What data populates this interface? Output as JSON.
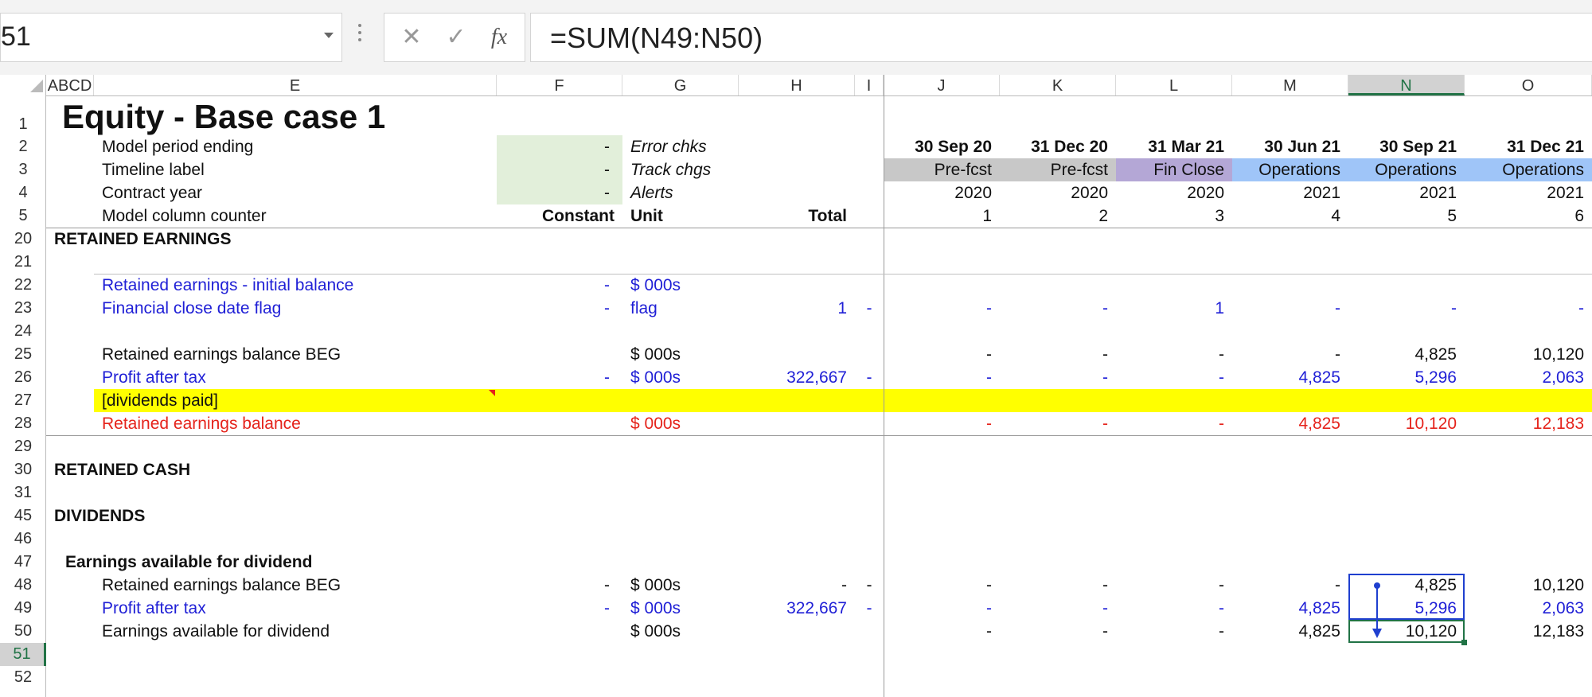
{
  "name_box": "51",
  "formula": "=SUM(N49:N50)",
  "formula_buttons": {
    "cancel": "✕",
    "enter": "✓",
    "fx": "fx"
  },
  "columns": [
    "ABCD",
    "E",
    "F",
    "G",
    "H",
    "I",
    "J",
    "K",
    "L",
    "M",
    "N",
    "O"
  ],
  "selected_column": "N",
  "rows": [
    "1",
    "2",
    "3",
    "4",
    "5",
    "20",
    "21",
    "22",
    "23",
    "24",
    "25",
    "26",
    "27",
    "28",
    "29",
    "30",
    "31",
    "45",
    "46",
    "47",
    "48",
    "49",
    "50",
    "51",
    "52"
  ],
  "selected_row": "51",
  "title": "Equity - Base case 1",
  "header_rows": {
    "r2": {
      "label": "Model period ending",
      "f": "-",
      "g": "Error chks"
    },
    "r3": {
      "label": "Timeline label",
      "f": "-",
      "g": "Track chgs"
    },
    "r4": {
      "label": "Contract year",
      "f": "-",
      "g": "Alerts"
    },
    "r5": {
      "label": "Model column counter",
      "f": "Constant",
      "g": "Unit",
      "h": "Total"
    }
  },
  "periods": [
    {
      "date": "30 Sep 20",
      "label": "Pre-fcst",
      "year": "2020",
      "counter": "1",
      "bg": "#c8c8c8"
    },
    {
      "date": "31 Dec 20",
      "label": "Pre-fcst",
      "year": "2020",
      "counter": "2",
      "bg": "#c8c8c8"
    },
    {
      "date": "31 Mar 21",
      "label": "Fin Close",
      "year": "2020",
      "counter": "3",
      "bg": "#b4a7d6"
    },
    {
      "date": "30 Jun 21",
      "label": "Operations",
      "year": "2021",
      "counter": "4",
      "bg": "#9fc5f8"
    },
    {
      "date": "30 Sep 21",
      "label": "Operations",
      "year": "2021",
      "counter": "5",
      "bg": "#9fc5f8"
    },
    {
      "date": "31 Dec 21",
      "label": "Operations",
      "year": "2021",
      "counter": "6",
      "bg": "#9fc5f8"
    }
  ],
  "sections": {
    "retained_earnings": "RETAINED EARNINGS",
    "retained_cash": "RETAINED CASH",
    "dividends": "DIVIDENDS",
    "earnings_available": "Earnings available for dividend"
  },
  "lines": {
    "r22": {
      "label": "Retained earnings - initial balance",
      "f": "-",
      "unit": "$ 000s"
    },
    "r23": {
      "label": "Financial close date flag",
      "f": "-",
      "unit": "flag",
      "total": "1",
      "i": "-",
      "vals": [
        "-",
        "-",
        "1",
        "-",
        "-",
        "-"
      ]
    },
    "r25": {
      "label": "Retained earnings balance BEG",
      "unit": "$ 000s",
      "vals": [
        "-",
        "-",
        "-",
        "-",
        "4,825",
        "10,120"
      ]
    },
    "r26": {
      "label": "Profit after tax",
      "f": "-",
      "unit": "$ 000s",
      "total": "322,667",
      "i": "-",
      "vals": [
        "-",
        "-",
        "-",
        "4,825",
        "5,296",
        "2,063"
      ]
    },
    "r27": {
      "label": "[dividends paid]"
    },
    "r28": {
      "label": "Retained earnings balance",
      "unit": "$ 000s",
      "vals": [
        "-",
        "-",
        "-",
        "4,825",
        "10,120",
        "12,183"
      ]
    },
    "r49": {
      "label": "Retained earnings balance BEG",
      "f": "-",
      "unit": "$ 000s",
      "total": "-",
      "i": "-",
      "vals": [
        "-",
        "-",
        "-",
        "-",
        "4,825",
        "10,120"
      ]
    },
    "r50": {
      "label": "Profit after tax",
      "f": "-",
      "unit": "$ 000s",
      "total": "322,667",
      "i": "-",
      "vals": [
        "-",
        "-",
        "-",
        "4,825",
        "5,296",
        "2,063"
      ]
    },
    "r51": {
      "label": "Earnings available for dividend",
      "unit": "$ 000s",
      "vals": [
        "-",
        "-",
        "-",
        "4,825",
        "10,120",
        "12,183"
      ]
    }
  },
  "colors": {
    "highlight_yellow": "#ffff00",
    "input_green": "#e2efda",
    "blue_text": "#1f1fd6",
    "red_text": "#e5231b",
    "excel_green": "#217346",
    "trace_blue": "#1f3fcf"
  }
}
